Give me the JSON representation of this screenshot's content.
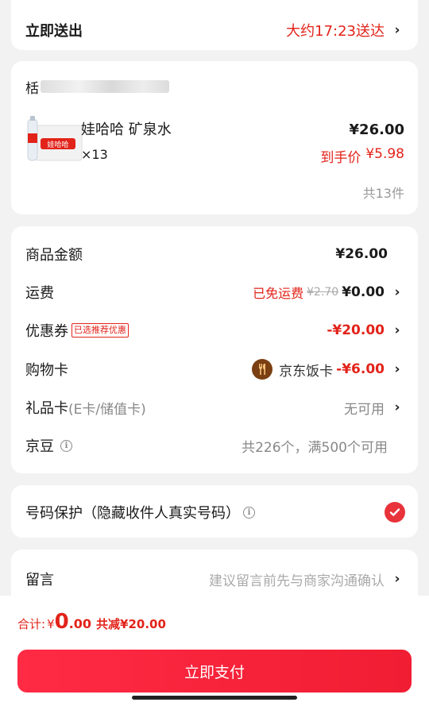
{
  "delivery": {
    "label": "立即送出",
    "eta": "大约17:23送达"
  },
  "store": {
    "name": "栝"
  },
  "product": {
    "name": "娃哈哈 矿泉水",
    "quantity": "×13",
    "price": "¥26.00",
    "final_price_label": "到手价",
    "final_price": "¥5.98",
    "total_count": "共13件"
  },
  "fees": {
    "goods_amount": {
      "label": "商品金额",
      "value": "¥26.00"
    },
    "shipping": {
      "label": "运费",
      "free_text": "已免运费",
      "original": "¥2.70",
      "value": "¥0.00"
    },
    "coupon": {
      "label": "优惠券",
      "tag": "已选推荐优惠",
      "value": "-¥20.00"
    },
    "shopping_card": {
      "label": "购物卡",
      "card_name": "京东饭卡",
      "value": "-¥6.00"
    },
    "gift_card": {
      "label": "礼品卡",
      "sub": "(E卡/储值卡)",
      "value": "无可用"
    },
    "jd_beans": {
      "label": "京豆",
      "value": "共226个，满500个可用"
    }
  },
  "privacy": {
    "label": "号码保护（隐藏收件人真实号码）",
    "checked": true
  },
  "message": {
    "label": "留言",
    "placeholder": "建议留言前先与商家沟通确认"
  },
  "footer": {
    "total_label": "合计:",
    "total_currency": "¥",
    "total_int": "0",
    "total_dec": ".00",
    "discount_text": "共减¥20.00",
    "pay_button": "立即支付"
  },
  "colors": {
    "accent": "#e2231a",
    "button": "#f01d33"
  },
  "icons": {
    "chevron": "chevron-right-icon",
    "info": "info-icon",
    "fork": "fork-spoon-icon",
    "check": "check-circle-icon"
  }
}
